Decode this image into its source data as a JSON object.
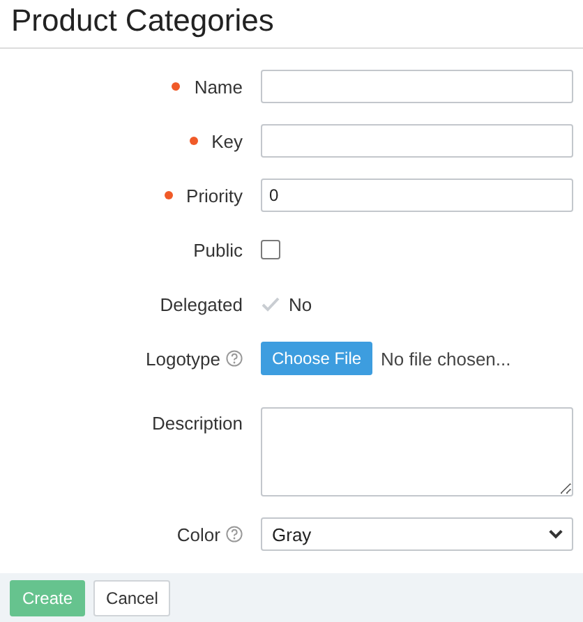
{
  "title": "Product Categories",
  "fields": [
    {
      "kind": "text",
      "label": "Name",
      "required": true
    },
    {
      "kind": "text",
      "label": "Key",
      "required": true
    },
    {
      "kind": "text",
      "label": "Priority",
      "required": true,
      "value": "0"
    },
    {
      "kind": "checkbox",
      "label": "Public",
      "checked": false
    },
    {
      "kind": "readonly",
      "label": "Delegated",
      "checked": false,
      "value": "No"
    },
    {
      "kind": "file",
      "label": "Logotype",
      "help": true,
      "button": "Choose File",
      "status": "No file chosen..."
    },
    {
      "kind": "textarea",
      "label": "Description"
    },
    {
      "kind": "select",
      "label": "Color",
      "help": true,
      "value": "Gray"
    }
  ],
  "buttons": [
    {
      "label": "Create",
      "kind": "primary"
    },
    {
      "label": "Cancel",
      "kind": "secondary"
    }
  ]
}
